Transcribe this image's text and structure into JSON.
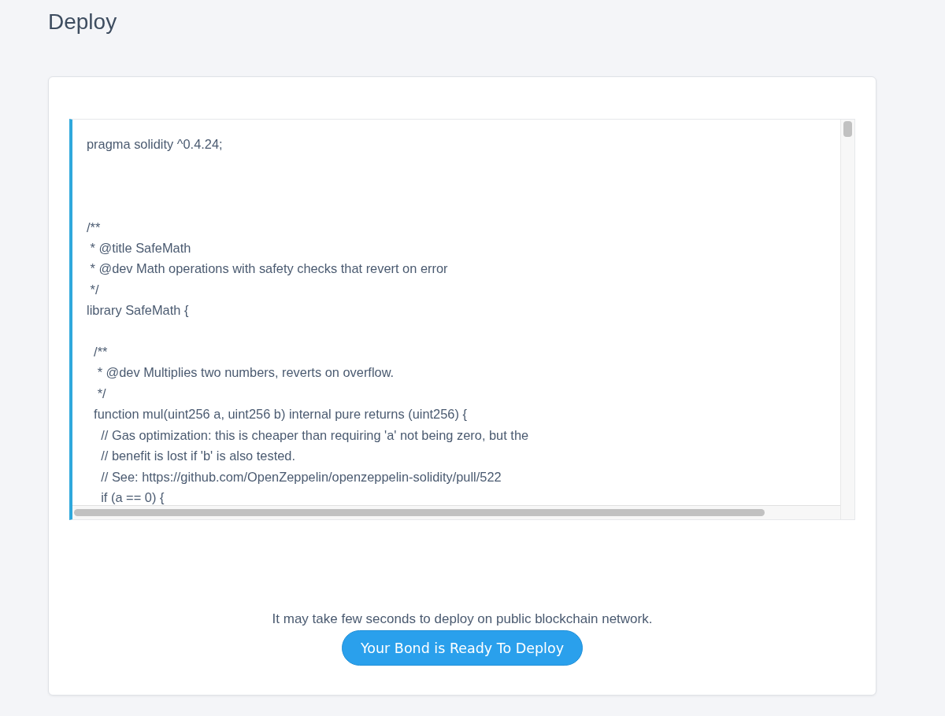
{
  "page": {
    "title": "Deploy"
  },
  "editor": {
    "code": "pragma solidity ^0.4.24;\n\n\n\n/**\n * @title SafeMath\n * @dev Math operations with safety checks that revert on error\n */\nlibrary SafeMath {\n\n  /**\n   * @dev Multiplies two numbers, reverts on overflow.\n   */\n  function mul(uint256 a, uint256 b) internal pure returns (uint256) {\n    // Gas optimization: this is cheaper than requiring 'a' not being zero, but the\n    // benefit is lost if 'b' is also tested.\n    // See: https://github.com/OpenZeppelin/openzeppelin-solidity/pull/522\n    if (a == 0) {"
  },
  "note": "It may take few seconds to deploy on public blockchain network.",
  "deploy_button": {
    "label": "Your Bond is Ready To Deploy"
  }
}
